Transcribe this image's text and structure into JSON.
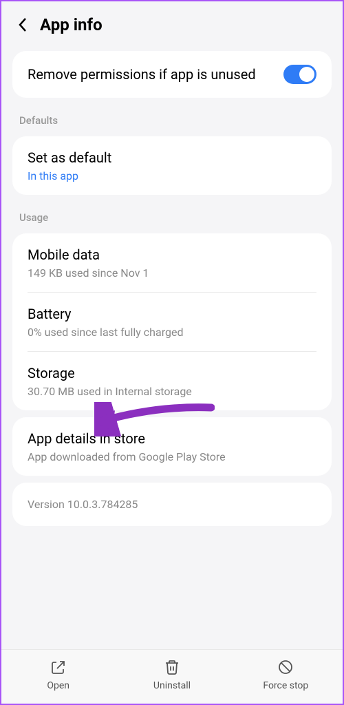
{
  "header": {
    "title": "App info"
  },
  "permissions": {
    "remove_unused_label": "Remove permissions if app is unused"
  },
  "sections": {
    "defaults_header": "Defaults",
    "usage_header": "Usage"
  },
  "defaults": {
    "set_default_label": "Set as default",
    "set_default_sub": "In this app"
  },
  "usage": {
    "mobile_data_label": "Mobile data",
    "mobile_data_sub": "149 KB used since Nov 1",
    "battery_label": "Battery",
    "battery_sub": "0% used since last fully charged",
    "storage_label": "Storage",
    "storage_sub": "30.70 MB used in Internal storage"
  },
  "store": {
    "details_label": "App details in store",
    "details_sub": "App downloaded from Google Play Store"
  },
  "version": {
    "text": "Version 10.0.3.784285"
  },
  "bottombar": {
    "open": "Open",
    "uninstall": "Uninstall",
    "force_stop": "Force stop"
  },
  "colors": {
    "accent": "#2f7cf6",
    "annotation": "#8b2fbf"
  }
}
